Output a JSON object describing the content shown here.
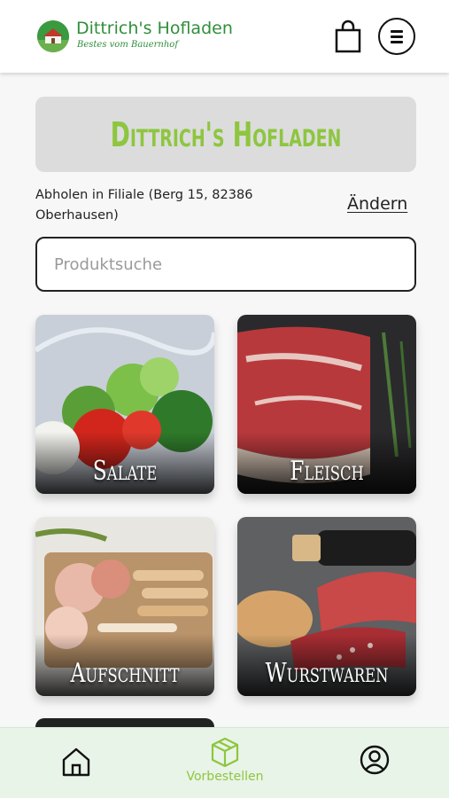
{
  "header": {
    "brand_name": "Dittrich's Hofladen",
    "brand_tagline": "Bestes vom Bauernhof",
    "cart_icon": "shopping-bag-icon",
    "menu_icon": "hamburger-menu-icon"
  },
  "banner": {
    "title": "Dittrich's Hofladen"
  },
  "pickup": {
    "text": "Abholen in Filiale (Berg 15, 82386 Oberhausen)",
    "change_label": "Ändern"
  },
  "search": {
    "placeholder": "Produktsuche",
    "value": ""
  },
  "categories": [
    {
      "label": "Salate"
    },
    {
      "label": "Fleisch"
    },
    {
      "label": "Aufschnitt"
    },
    {
      "label": "Wurstwaren"
    }
  ],
  "bottom_nav": {
    "home_icon": "home-icon",
    "preorder_label": "Vorbestellen",
    "preorder_icon": "box-icon",
    "account_icon": "user-circle-icon"
  },
  "colors": {
    "brand_green": "#2f8f3a",
    "accent_lime": "#8dc63f",
    "nav_bg": "#e9f4e8"
  }
}
